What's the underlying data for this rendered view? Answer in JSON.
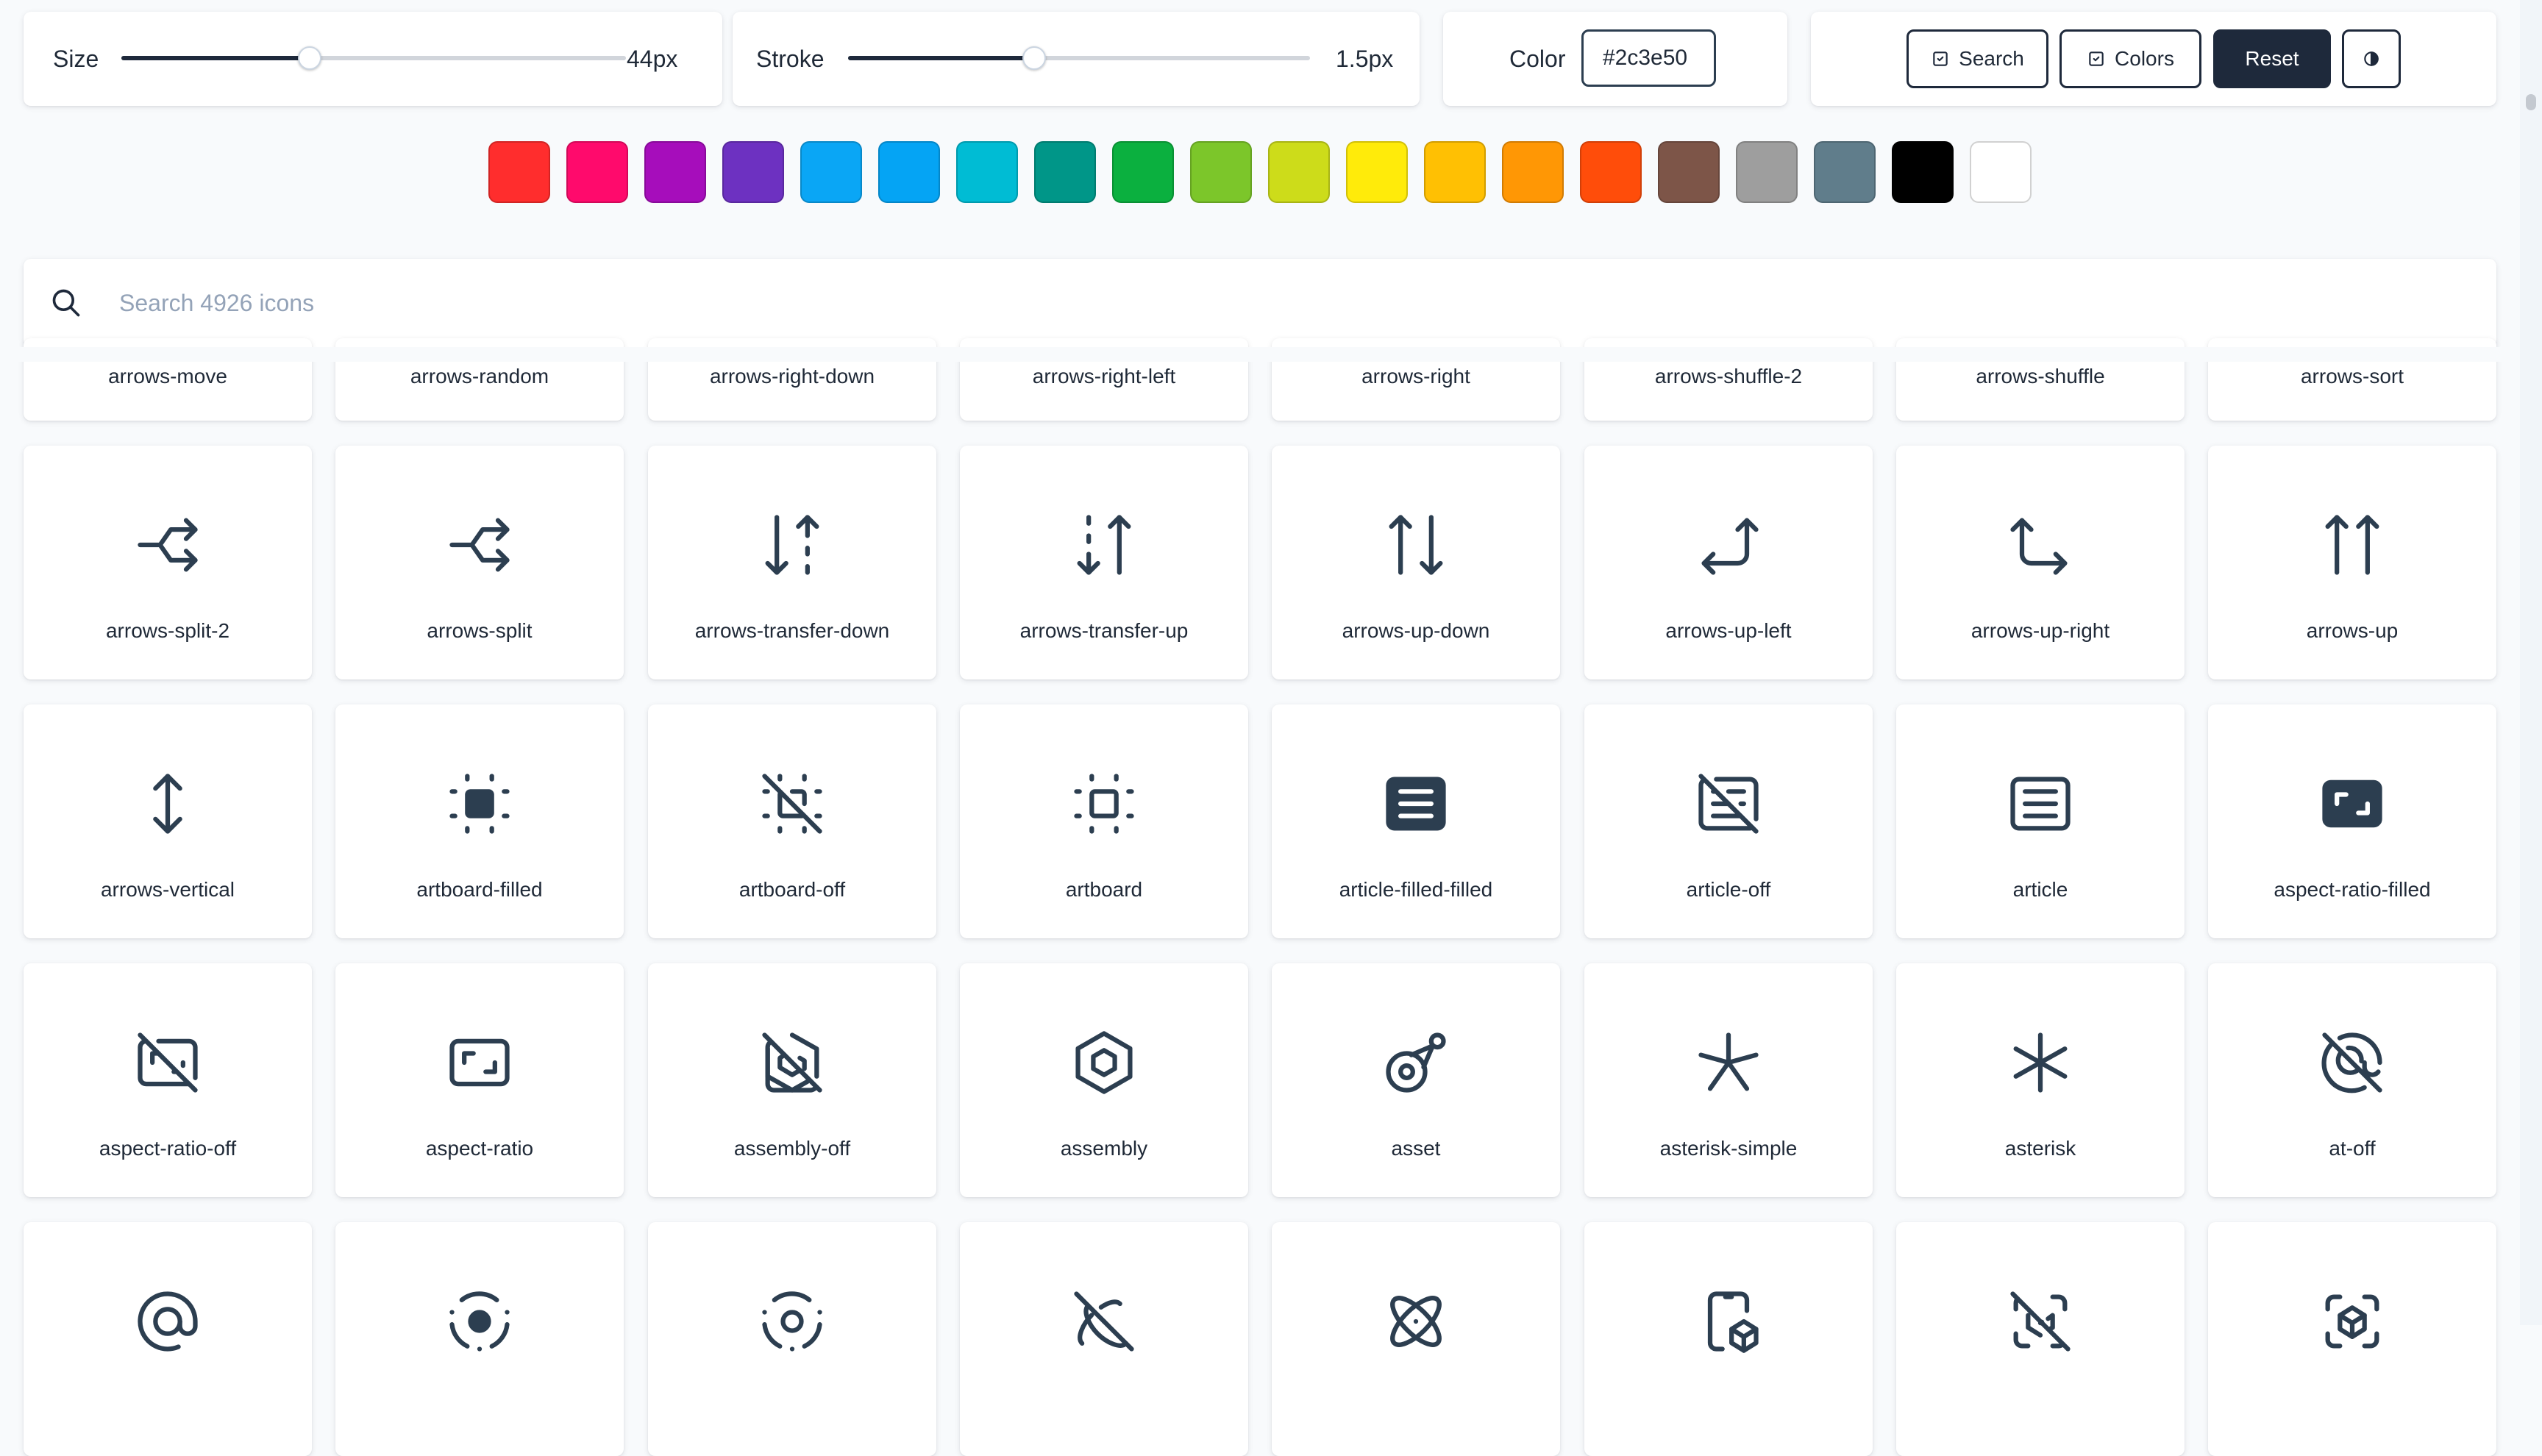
{
  "controls": {
    "size": {
      "label": "Size",
      "value": "44px",
      "level": 0.37
    },
    "stroke": {
      "label": "Stroke",
      "value": "1.5px",
      "level": 0.4
    },
    "color": {
      "label": "Color",
      "value": "#2c3e50"
    },
    "buttons": {
      "search": "Search",
      "colors": "Colors",
      "reset": "Reset",
      "theme_icon": "half-circle-icon"
    }
  },
  "swatches": [
    "#ff2d2d",
    "#ff0a6c",
    "#a60dbb",
    "#6d31c1",
    "#0aa6f5",
    "#05a4f4",
    "#00bcd4",
    "#009688",
    "#0bb03f",
    "#7cc62a",
    "#cddc1a",
    "#ffeb0a",
    "#ffc003",
    "#ff9705",
    "#ff4d0a",
    "#7d5548",
    "#9e9e9e",
    "#607d8b",
    "#000000",
    "#ffffff"
  ],
  "search": {
    "placeholder": "Search 4926 icons",
    "icon": "search-icon"
  },
  "rows": [
    {
      "partial": true,
      "icons": [
        {
          "name": "arrows-move"
        },
        {
          "name": "arrows-random"
        },
        {
          "name": "arrows-right-down"
        },
        {
          "name": "arrows-right-left"
        },
        {
          "name": "arrows-right"
        },
        {
          "name": "arrows-shuffle-2"
        },
        {
          "name": "arrows-shuffle"
        },
        {
          "name": "arrows-sort"
        }
      ]
    },
    {
      "icons": [
        {
          "name": "arrows-split-2",
          "icon": "split"
        },
        {
          "name": "arrows-split",
          "icon": "split"
        },
        {
          "name": "arrows-transfer-down",
          "icon": "transfer-down"
        },
        {
          "name": "arrows-transfer-up",
          "icon": "transfer-up"
        },
        {
          "name": "arrows-up-down",
          "icon": "up-down"
        },
        {
          "name": "arrows-up-left",
          "icon": "up-left"
        },
        {
          "name": "arrows-up-right",
          "icon": "up-right"
        },
        {
          "name": "arrows-up",
          "icon": "up"
        }
      ]
    },
    {
      "icons": [
        {
          "name": "arrows-vertical",
          "icon": "vertical"
        },
        {
          "name": "artboard-filled",
          "icon": "artboard-filled"
        },
        {
          "name": "artboard-off",
          "icon": "artboard-off"
        },
        {
          "name": "artboard",
          "icon": "artboard"
        },
        {
          "name": "article-filled-filled",
          "icon": "article-filled"
        },
        {
          "name": "article-off",
          "icon": "article-off"
        },
        {
          "name": "article",
          "icon": "article"
        },
        {
          "name": "aspect-ratio-filled",
          "icon": "aspect-filled"
        }
      ]
    },
    {
      "icons": [
        {
          "name": "aspect-ratio-off",
          "icon": "aspect-off"
        },
        {
          "name": "aspect-ratio",
          "icon": "aspect"
        },
        {
          "name": "assembly-off",
          "icon": "assembly-off"
        },
        {
          "name": "assembly",
          "icon": "assembly"
        },
        {
          "name": "asset",
          "icon": "asset"
        },
        {
          "name": "asterisk-simple",
          "icon": "asterisk-simple"
        },
        {
          "name": "asterisk",
          "icon": "asterisk"
        },
        {
          "name": "at-off",
          "icon": "at-off"
        }
      ]
    },
    {
      "partial_bottom": true,
      "icons": [
        {
          "icon": "at"
        },
        {
          "icon": "atom-2-filled"
        },
        {
          "icon": "atom-2"
        },
        {
          "icon": "atom-off"
        },
        {
          "icon": "atom"
        },
        {
          "icon": "augmented-reality-2"
        },
        {
          "icon": "augmented-reality-off"
        },
        {
          "icon": "augmented-reality"
        }
      ]
    }
  ]
}
